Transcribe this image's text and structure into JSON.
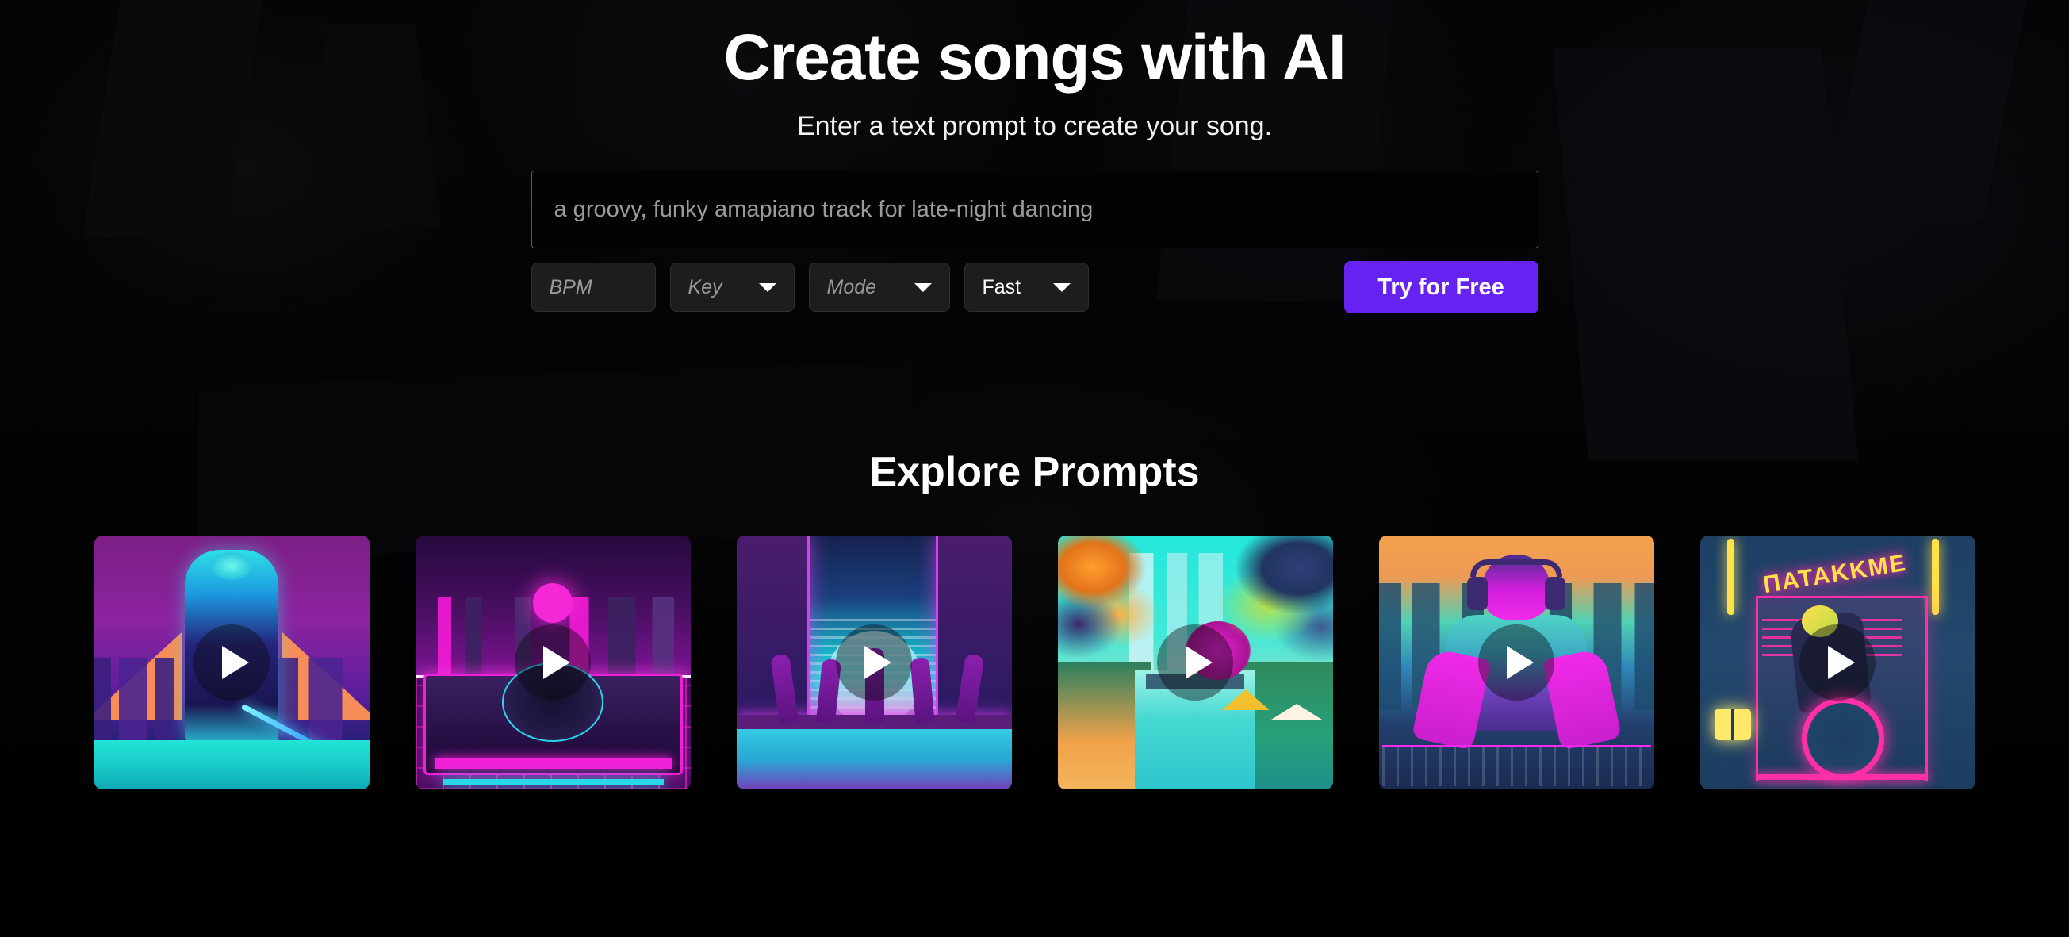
{
  "hero": {
    "title": "Create songs with AI",
    "subtitle": "Enter a text prompt to create your song."
  },
  "form": {
    "prompt_placeholder": "a groovy, funky amapiano track for late-night dancing",
    "prompt_value": "",
    "controls": {
      "bpm": {
        "label": "BPM",
        "value": "",
        "placeholder": "BPM"
      },
      "key": {
        "label": "Key",
        "value": "",
        "placeholder": "Key"
      },
      "mode": {
        "label": "Mode",
        "value": "",
        "placeholder": "Mode"
      },
      "speed": {
        "label": "Fast",
        "value": "Fast",
        "placeholder": "Fast"
      }
    },
    "cta_label": "Try for Free"
  },
  "explore": {
    "title": "Explore Prompts",
    "cards": [
      {
        "id": "card-1",
        "art": "cyber-samurai-neon-city",
        "play_label": "Play"
      },
      {
        "id": "card-2",
        "art": "synthwave-turntable-city",
        "play_label": "Play"
      },
      {
        "id": "card-3",
        "art": "neon-dancers-street",
        "play_label": "Play"
      },
      {
        "id": "card-4",
        "art": "tropical-neon-canal",
        "play_label": "Play"
      },
      {
        "id": "card-5",
        "art": "dj-with-headphones-sunset",
        "play_label": "Play"
      },
      {
        "id": "card-6",
        "art": "neon-sign-motorcycle-shop",
        "play_label": "Play",
        "sign_text": "ΠΑΤΑΚΚΜΕ"
      }
    ]
  },
  "colors": {
    "background": "#050506",
    "accent": "#6622f0",
    "text_primary": "#ffffff",
    "text_muted": "#9a9a9a",
    "input_border": "#5a5a5a",
    "control_bg": "#1d1d1f"
  }
}
